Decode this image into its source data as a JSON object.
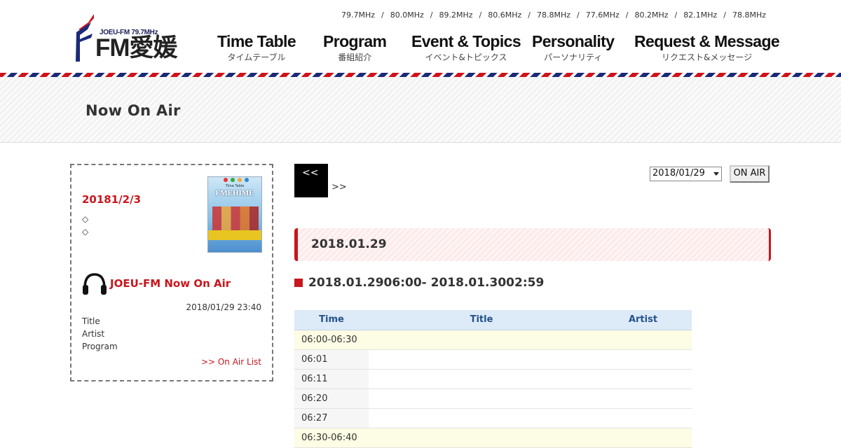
{
  "header": {
    "logo": {
      "small_text": "JOEU-FM 79.7MHz",
      "big_text": "FM愛媛",
      "colors": {
        "red": "#d0121b",
        "navy": "#1b2a78"
      }
    },
    "frequencies": [
      "79.7MHz",
      "80.0MHz",
      "89.2MHz",
      "80.6MHz",
      "78.8MHz",
      "77.6MHz",
      "80.2MHz",
      "82.1MHz",
      "78.8MHz"
    ],
    "frequency_separator": "/",
    "nav": [
      {
        "en": "Time Table",
        "jp": "タイムテーブル"
      },
      {
        "en": "Program",
        "jp": "番組紹介"
      },
      {
        "en": "Event & Topics",
        "jp": "イベント&トピックス"
      },
      {
        "en": "Personality",
        "jp": "パーソナリティ"
      },
      {
        "en": "Request & Message",
        "jp": "リクエスト&メッセージ"
      }
    ]
  },
  "banner": {
    "title": "Now On Air"
  },
  "sidebar": {
    "issue_date": "20181/2/3",
    "bullets": [
      "◇",
      "◇"
    ],
    "magazine": {
      "top_text": "Time Table",
      "title": "FMEHIME"
    },
    "onair": {
      "title": "JOEU-FM Now On Air",
      "timestamp": "2018/01/29 23:40",
      "labels": [
        "Title",
        "Artist",
        "Program"
      ],
      "list_link": ">> On Air List"
    }
  },
  "main": {
    "prev_label": "<<",
    "next_label": ">>",
    "date_select_value": "2018/01/29",
    "onair_button": "ON AIR",
    "day_heading": "2018.01.29",
    "range_heading": "2018.01.2906:00- 2018.01.3002:59",
    "table": {
      "headers": [
        "Time",
        "Title",
        "Artist"
      ],
      "rows": [
        {
          "type": "block",
          "time": "06:00-06:30",
          "title": "",
          "artist": ""
        },
        {
          "type": "song",
          "time": "06:01",
          "title": "",
          "artist": ""
        },
        {
          "type": "song",
          "time": "06:11",
          "title": "",
          "artist": ""
        },
        {
          "type": "song",
          "time": "06:20",
          "title": "",
          "artist": ""
        },
        {
          "type": "song",
          "time": "06:27",
          "title": "",
          "artist": ""
        },
        {
          "type": "block",
          "time": "06:30-06:40",
          "title": "",
          "artist": ""
        }
      ]
    }
  },
  "colors": {
    "accent_red": "#c8161d",
    "table_header_bg": "#ddeaf7",
    "table_header_text": "#24538a",
    "block_row_bg": "#fdfce4"
  }
}
